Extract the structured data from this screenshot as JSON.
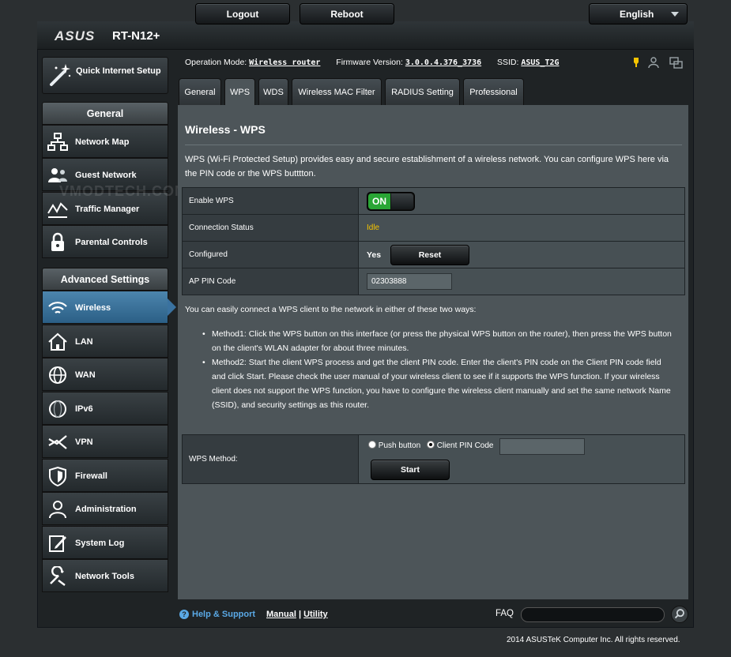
{
  "header": {
    "brand": "ASUS",
    "model": "RT-N12+",
    "logout_label": "Logout",
    "reboot_label": "Reboot",
    "language": "English"
  },
  "status": {
    "operation_mode_label": "Operation Mode:",
    "operation_mode_value": "Wireless router",
    "firmware_label": "Firmware Version:",
    "firmware_value": "3.0.0.4.376_3736",
    "ssid_label": "SSID:",
    "ssid_value": "ASUS_T2G"
  },
  "sidebar": {
    "quick_setup": "Quick Internet Setup",
    "general_heading": "General",
    "general_items": [
      {
        "label": "Network Map",
        "icon": "network-map-icon"
      },
      {
        "label": "Guest Network",
        "icon": "guest-network-icon"
      },
      {
        "label": "Traffic Manager",
        "icon": "traffic-manager-icon"
      },
      {
        "label": "Parental Controls",
        "icon": "parental-controls-icon"
      }
    ],
    "advanced_heading": "Advanced Settings",
    "advanced_items": [
      {
        "label": "Wireless",
        "icon": "wireless-icon",
        "active": true
      },
      {
        "label": "LAN",
        "icon": "lan-icon"
      },
      {
        "label": "WAN",
        "icon": "wan-icon"
      },
      {
        "label": "IPv6",
        "icon": "ipv6-icon"
      },
      {
        "label": "VPN",
        "icon": "vpn-icon"
      },
      {
        "label": "Firewall",
        "icon": "firewall-icon"
      },
      {
        "label": "Administration",
        "icon": "administration-icon"
      },
      {
        "label": "System Log",
        "icon": "system-log-icon"
      },
      {
        "label": "Network Tools",
        "icon": "network-tools-icon"
      }
    ]
  },
  "tabs": [
    {
      "label": "General"
    },
    {
      "label": "WPS",
      "active": true
    },
    {
      "label": "WDS"
    },
    {
      "label": "Wireless MAC Filter"
    },
    {
      "label": "RADIUS Setting"
    },
    {
      "label": "Professional"
    }
  ],
  "main": {
    "title": "Wireless - WPS",
    "description": "WPS (Wi-Fi Protected Setup) provides easy and secure establishment of a wireless network. You can configure WPS here via the PIN code or the WPS butttton.",
    "settings": {
      "enable_wps_label": "Enable WPS",
      "enable_wps_state": "ON",
      "connection_status_label": "Connection Status",
      "connection_status_value": "Idle",
      "configured_label": "Configured",
      "configured_value": "Yes",
      "reset_label": "Reset",
      "ap_pin_label": "AP PIN Code",
      "ap_pin_value": "02303888"
    },
    "ways_intro": "You can easily connect a WPS client to the network in either of these two ways:",
    "methods": [
      "Method1: Click the WPS button on this interface (or press the physical WPS button on the router), then press the WPS button on the client's WLAN adapter for about three minutes.",
      "Method2: Start the client WPS process and get the client PIN code. Enter the client's PIN code on the Client PIN code field and click Start. Please check the user manual of your wireless client to see if it supports the WPS function. If your wireless client does not support the WPS function, you have to configure the wireless client manually and set the same network Name (SSID), and security settings as this router."
    ],
    "wps_method_label": "WPS Method:",
    "push_button_label": "Push button",
    "client_pin_label": "Client PIN Code",
    "start_label": "Start"
  },
  "footer": {
    "help": "Help & Support",
    "manual": "Manual",
    "sep": "|",
    "utility": "Utility",
    "faq": "FAQ",
    "copyright": "2014 ASUSTeK Computer Inc. All rights reserved."
  },
  "watermark": "VMODTECH.COM",
  "colors": {
    "accent_blue": "#3a72a0",
    "toggle_on": "#29a635",
    "idle_yellow": "#f5c400",
    "help_blue": "#5aa9e6"
  }
}
